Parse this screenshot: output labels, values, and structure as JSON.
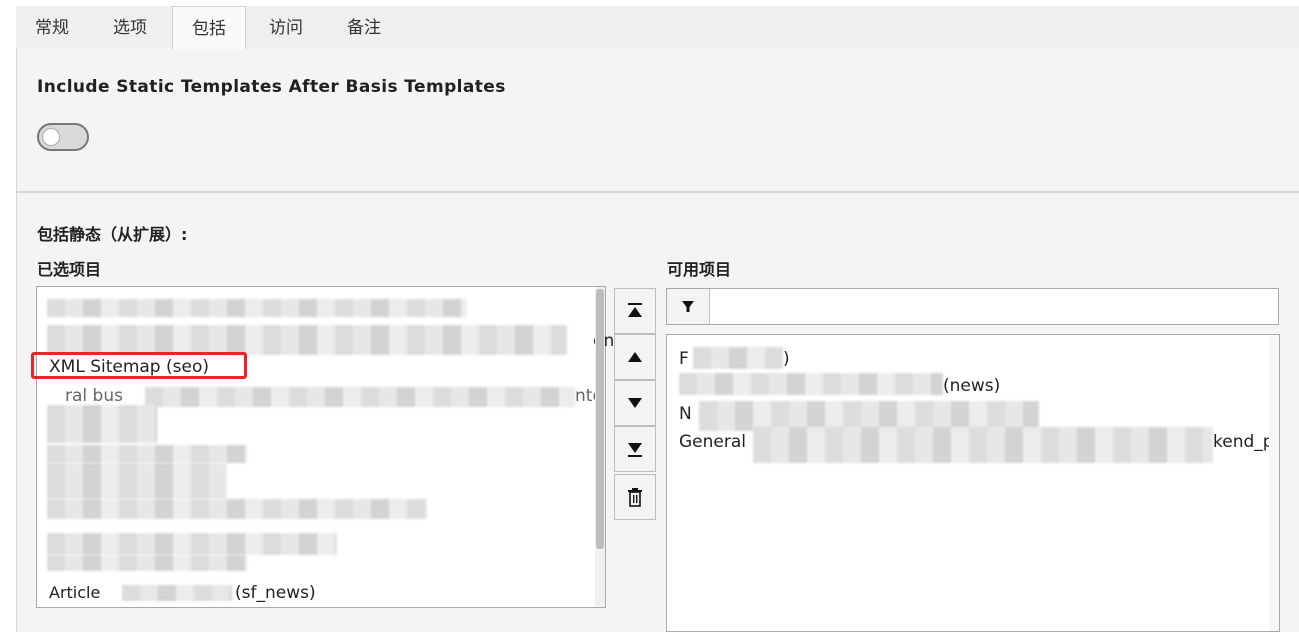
{
  "tabs": [
    {
      "label": "常规"
    },
    {
      "label": "选项"
    },
    {
      "label": "包括"
    },
    {
      "label": "访问"
    },
    {
      "label": "备注"
    }
  ],
  "active_tab_index": 2,
  "include_section": {
    "title": "Include Static Templates After Basis Templates",
    "toggle_on": false
  },
  "static_section": {
    "title": "包括静态（从扩展）:",
    "selected_label": "已选项目",
    "available_label": "可用项目",
    "selected_items": [
      {
        "text": "ent"
      },
      {
        "text": "XML Sitemap (seo)"
      },
      {
        "text": "ral bus"
      },
      {
        "text": "nte"
      },
      {
        "text": "Article"
      },
      {
        "text": "(sf_news)"
      }
    ],
    "available_items": [
      {
        "text": "F"
      },
      {
        "text": ")"
      },
      {
        "text": "(news)"
      },
      {
        "text": "N"
      },
      {
        "text": "General"
      },
      {
        "text": "kend_p"
      }
    ],
    "filter": {
      "value": "",
      "placeholder": ""
    }
  },
  "colors": {
    "highlight": "#e8262a"
  },
  "icons": {
    "move_top": "move-to-top-icon",
    "move_up": "move-up-icon",
    "move_down": "move-down-icon",
    "move_bottom": "move-to-bottom-icon",
    "delete": "trash-icon",
    "filter": "filter-icon"
  }
}
